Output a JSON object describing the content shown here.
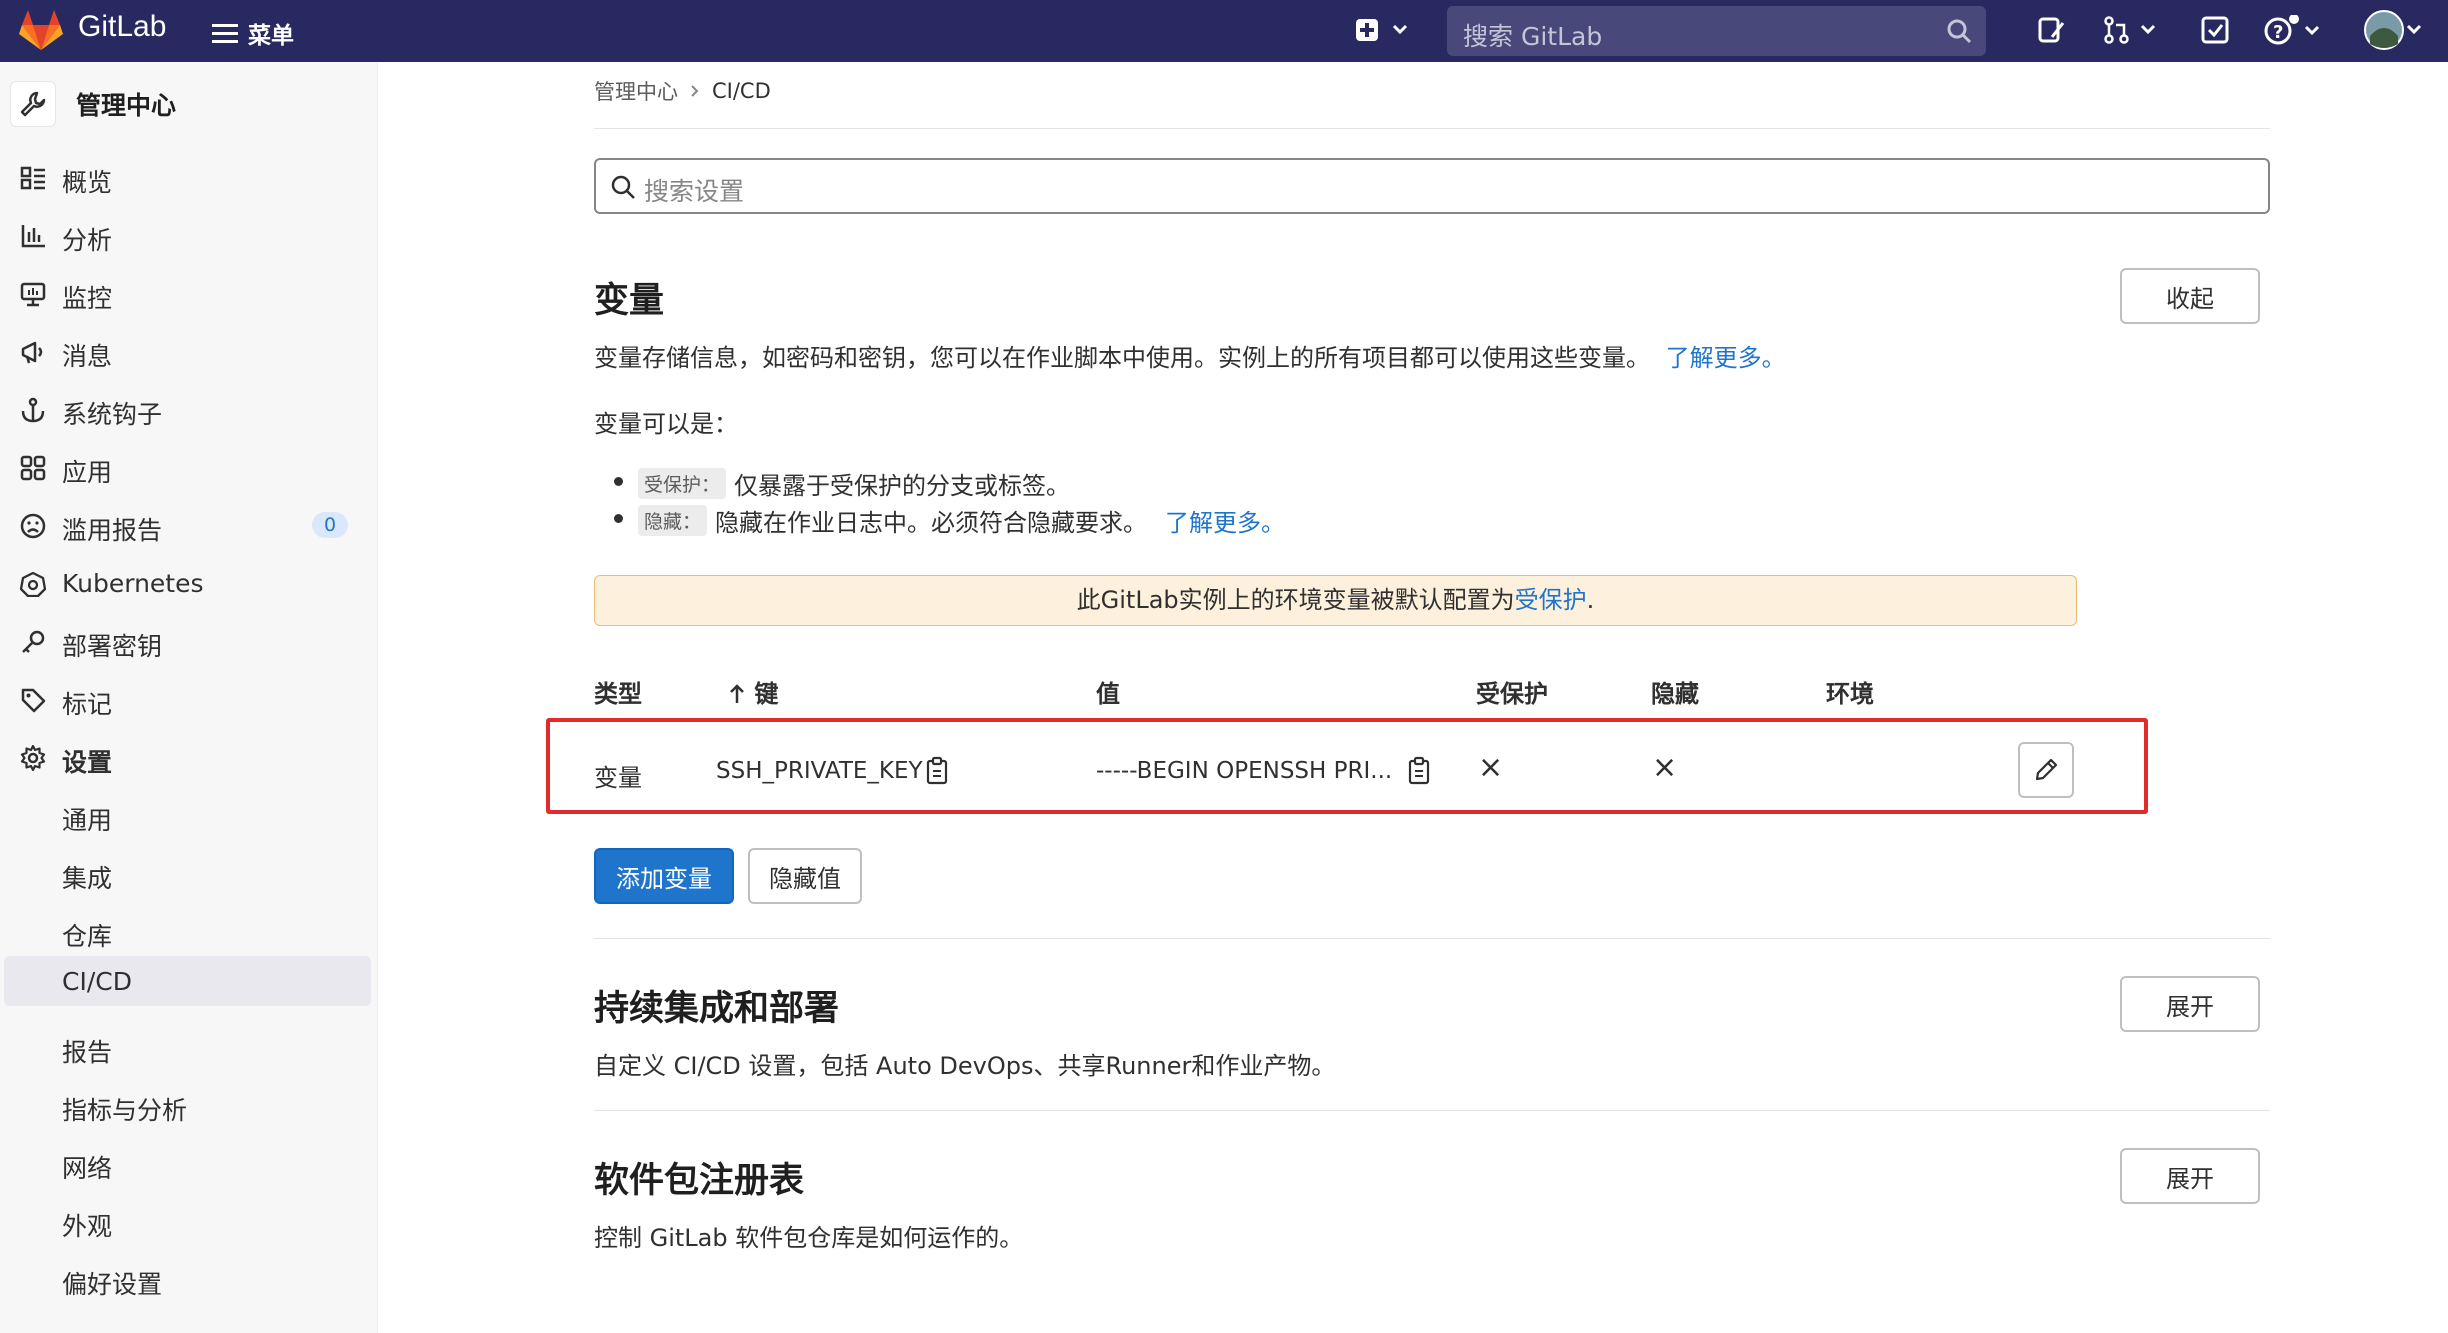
{
  "topbar": {
    "brand": "GitLab",
    "menu_label": "菜单",
    "search_placeholder": "搜索 GitLab"
  },
  "sidebar": {
    "header": "管理中心",
    "items": [
      {
        "label": "概览",
        "icon": "overview-icon"
      },
      {
        "label": "分析",
        "icon": "chart-icon"
      },
      {
        "label": "监控",
        "icon": "monitor-icon"
      },
      {
        "label": "消息",
        "icon": "megaphone-icon"
      },
      {
        "label": "系统钩子",
        "icon": "anchor-icon"
      },
      {
        "label": "应用",
        "icon": "grid-icon"
      },
      {
        "label": "滥用报告",
        "icon": "face-icon",
        "badge": "0"
      },
      {
        "label": "Kubernetes",
        "icon": "kubernetes-icon"
      },
      {
        "label": "部署密钥",
        "icon": "key-icon"
      },
      {
        "label": "标记",
        "icon": "label-icon"
      },
      {
        "label": "设置",
        "icon": "settings-icon"
      }
    ],
    "sub_items": [
      "通用",
      "集成",
      "仓库",
      "CI/CD",
      "报告",
      "指标与分析",
      "网络",
      "外观",
      "偏好设置"
    ],
    "active_sub_item": "CI/CD"
  },
  "breadcrumb": {
    "parent": "管理中心",
    "current": "CI/CD"
  },
  "search_settings": {
    "placeholder": "搜索设置"
  },
  "variables": {
    "title": "变量",
    "collapse_button": "收起",
    "description": "变量存储信息，如密码和密钥，您可以在作业脚本中使用。实例上的所有项目都可以使用这些变量。",
    "learn_more": "了解更多。",
    "can_be": "变量可以是：",
    "bullets": [
      {
        "tag": "受保护：",
        "text": "仅暴露于受保护的分支或标签。",
        "link": ""
      },
      {
        "tag": "隐藏：",
        "text": "隐藏在作业日志中。必须符合隐藏要求。",
        "link": "了解更多。"
      }
    ],
    "alert_text": "此GitLab实例上的环境变量被默认配置为",
    "alert_link": "受保护",
    "alert_end": ".",
    "table": {
      "headers": {
        "type": "类型",
        "key": "键",
        "value": "值",
        "protected": "受保护",
        "masked": "隐藏",
        "environment": "环境"
      },
      "rows": [
        {
          "type": "变量",
          "key": "SSH_PRIVATE_KEY",
          "value": "-----BEGIN OPENSSH PRI...",
          "protected": "×",
          "masked": "×",
          "environment": ""
        }
      ]
    },
    "add_button": "添加变量",
    "reveal_button": "隐藏值"
  },
  "cicd_section": {
    "title": "持续集成和部署",
    "description": "自定义 CI/CD 设置，包括 Auto DevOps、共享Runner和作业产物。",
    "button": "展开"
  },
  "package_section": {
    "title": "软件包注册表",
    "description": "控制 GitLab 软件包仓库是如何运作的。",
    "button": "展开"
  }
}
